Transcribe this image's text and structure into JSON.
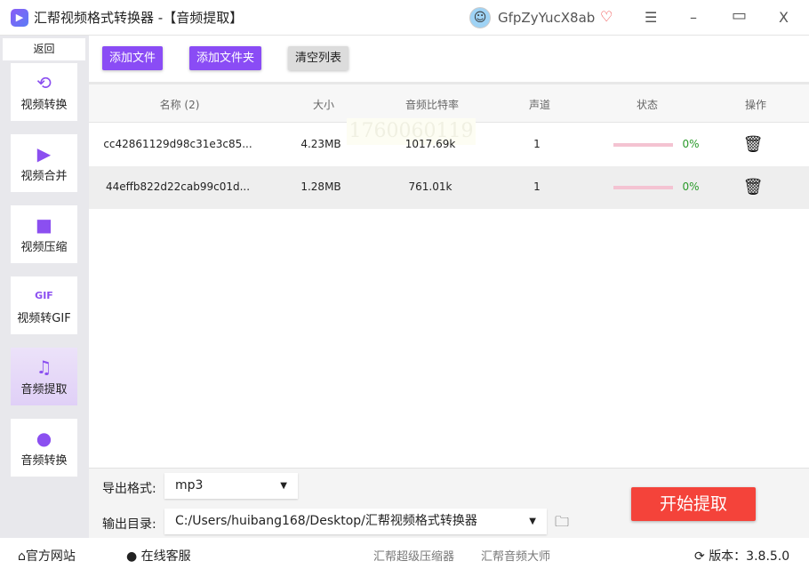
{
  "window": {
    "app_name": "汇帮视频格式转换器",
    "subtitle": "-【音频提取】",
    "username": "GfpZyYucX8ab",
    "menu_icon": "☰",
    "minimize_icon": "–",
    "maximize_icon": "▭",
    "close_icon": "X"
  },
  "sidebar": {
    "back": "返回",
    "active_color": "#e4d6f8",
    "items": [
      {
        "label": "视频转换",
        "icon": "video-convert-icon"
      },
      {
        "label": "视频合并",
        "icon": "video-merge-icon"
      },
      {
        "label": "视频压缩",
        "icon": "video-compress-icon"
      },
      {
        "label": "视频转GIF",
        "icon": "gif-icon"
      },
      {
        "label": "音频提取",
        "icon": "music-note-icon",
        "active": true
      },
      {
        "label": "音频转换",
        "icon": "microphone-icon"
      }
    ]
  },
  "toolbar": {
    "add_file": "添加文件",
    "add_folder": "添加文件夹",
    "clear_list": "清空列表"
  },
  "table": {
    "headers": [
      "名称 (2)",
      "大小",
      "音频比特率",
      "声道",
      "状态",
      "操作"
    ],
    "rows": [
      {
        "name": "cc42861129d98c31e3c85...",
        "size": "4.23MB",
        "bitrate": "1017.69k",
        "channels": "1",
        "progress": "0%"
      },
      {
        "name": "44effb822d22cab99c01d...",
        "size": "1.28MB",
        "bitrate": "761.01k",
        "channels": "1",
        "progress": "0%"
      }
    ],
    "watermark": "1760060119"
  },
  "output": {
    "format_label": "导出格式:",
    "format_value": "mp3",
    "dir_label": "输出目录:",
    "dir_value": "C:/Users/huibang168/Desktop/汇帮视频格式转换器",
    "start": "开始提取",
    "accent": "#f4433a"
  },
  "footer": {
    "website": "官方网站",
    "support": "在线客服",
    "link1": "汇帮超级压缩器",
    "link2": "汇帮音频大师",
    "version": "版本：3.8.5.0"
  }
}
